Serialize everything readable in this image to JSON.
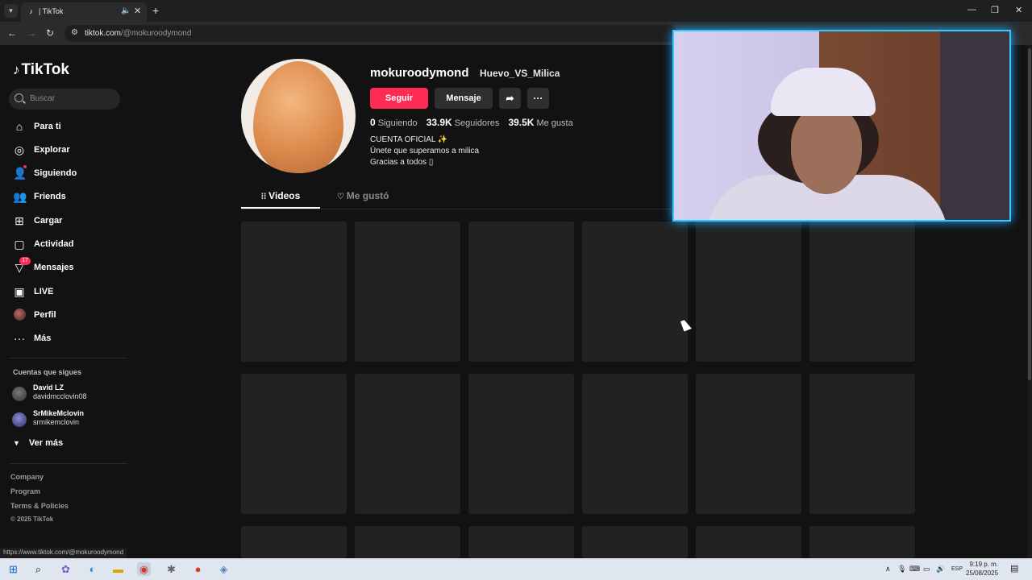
{
  "browser": {
    "tab_title": "| TikTok",
    "tab_audio_icon": "speaker-icon",
    "url_host": "tiktok.com",
    "url_path": "/@mokuroodymond"
  },
  "sidebar": {
    "logo_text": "TikTok",
    "search_placeholder": "Buscar",
    "nav": [
      {
        "label": "Para ti",
        "icon": "home-icon"
      },
      {
        "label": "Explorar",
        "icon": "compass-icon"
      },
      {
        "label": "Siguiendo",
        "icon": "following-icon"
      },
      {
        "label": "Friends",
        "icon": "friends-icon"
      },
      {
        "label": "Cargar",
        "icon": "upload-icon"
      },
      {
        "label": "Actividad",
        "icon": "activity-icon"
      },
      {
        "label": "Mensajes",
        "icon": "messages-icon",
        "badge": "17"
      },
      {
        "label": "LIVE",
        "icon": "live-icon"
      },
      {
        "label": "Perfil",
        "icon": "profile-avatar"
      },
      {
        "label": "Más",
        "icon": "more-icon"
      }
    ],
    "following_header": "Cuentas que sigues",
    "following": [
      {
        "name": "David LZ",
        "handle": "davidmcclovin08"
      },
      {
        "name": "SrMikeMclovin",
        "handle": "srmikemclovin"
      }
    ],
    "see_more": "Ver más",
    "footer_links": [
      "Company",
      "Program",
      "Terms & Policies"
    ],
    "copyright": "© 2025 TikTok"
  },
  "profile": {
    "username": "mokuroodymond",
    "nickname": "Huevo_VS_Milica",
    "follow_label": "Seguir",
    "message_label": "Mensaje",
    "following_count": "0",
    "following_label": "Siguiendo",
    "followers_count": "33.9K",
    "followers_label": "Seguidores",
    "likes_count": "39.5K",
    "likes_label": "Me gusta",
    "bio_lines": [
      "CUENTA OFICIAL ✨",
      "Únete que superamos a milica",
      "Gracias a todos ▯"
    ]
  },
  "tabs": {
    "videos": "Videos",
    "liked": "Me gustó"
  },
  "status_url": "https://www.tiktok.com/@mokuroodymond",
  "taskbar": {
    "lang": "ESP",
    "time": "9:19 p. m.",
    "date": "25/08/2025"
  },
  "colors": {
    "accent": "#fe2c55",
    "background": "#121212",
    "webcam_border": "#39c6ff"
  }
}
